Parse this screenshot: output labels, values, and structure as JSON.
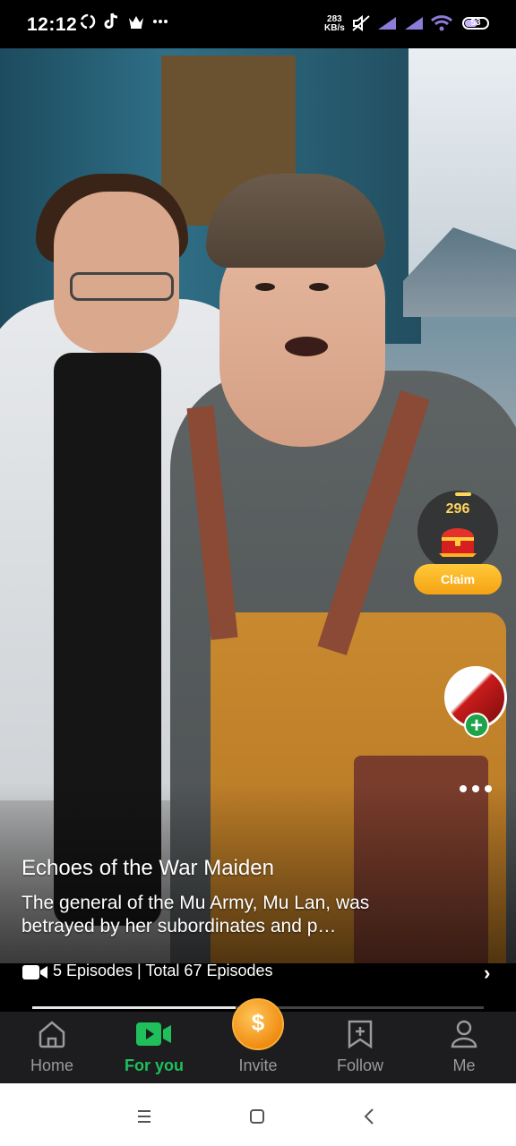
{
  "status_bar": {
    "time": "12:12",
    "net_speed_value": "283",
    "net_speed_unit": "KB/s",
    "battery": "53",
    "left_icons": [
      "sync-icon",
      "tiktok-icon",
      "crown-icon",
      "more-dots-icon"
    ],
    "right_icons": [
      "mute-icon",
      "signal-icon",
      "signal-icon",
      "wifi-icon",
      "battery-icon"
    ]
  },
  "reward": {
    "count": "296",
    "claim_label": "Claim",
    "accent": "#ffc93a"
  },
  "drama": {
    "title": "Echoes of the War Maiden",
    "description": "The general of the Mu Army, Mu Lan, was betrayed by her subordinates and p…",
    "episodes_text": "5 Episodes | Total 67 Episodes",
    "progress": 0.45
  },
  "tabs": [
    {
      "label": "Home",
      "icon": "home-icon",
      "active": false
    },
    {
      "label": "For you",
      "icon": "video-camera-icon",
      "active": true
    },
    {
      "label": "Invite",
      "icon": "coin-icon",
      "active": false
    },
    {
      "label": "Follow",
      "icon": "bookmark-plus-icon",
      "active": false
    },
    {
      "label": "Me",
      "icon": "profile-icon",
      "active": false
    }
  ],
  "colors": {
    "active_tab": "#1fbf5b",
    "inactive_tab": "#9a9a9a",
    "follow_plus": "#1ea34a",
    "tabbar_bg": "#1d1d1f"
  }
}
